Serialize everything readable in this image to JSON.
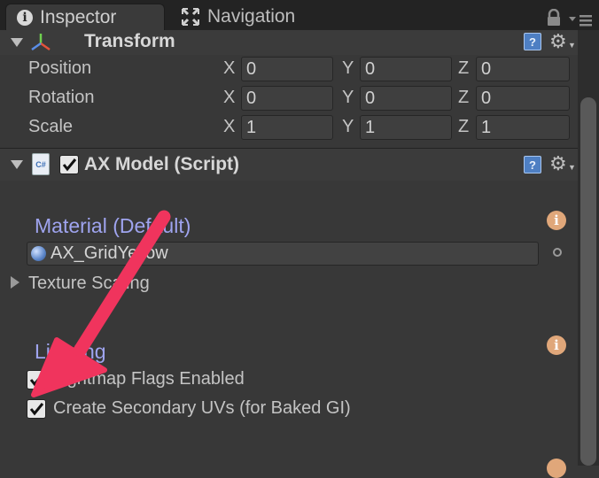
{
  "tabs": {
    "inspector": "Inspector",
    "navigation": "Navigation"
  },
  "transform": {
    "title": "Transform",
    "rows": [
      {
        "label": "Position",
        "x": "0",
        "y": "0",
        "z": "0"
      },
      {
        "label": "Rotation",
        "x": "0",
        "y": "0",
        "z": "0"
      },
      {
        "label": "Scale",
        "x": "1",
        "y": "1",
        "z": "1"
      }
    ],
    "axes": {
      "x": "X",
      "y": "Y",
      "z": "Z"
    }
  },
  "script_component": {
    "title": "AX Model (Script)",
    "icon_text": "C#",
    "enabled": true
  },
  "material_section": {
    "title": "Material (Default)",
    "field_value": "AX_GridYellow",
    "texture_scaling_label": "Texture Scaling"
  },
  "lighting_section": {
    "title": "Lighting",
    "lightmap_flags_label": "Lightmap Flags Enabled",
    "lightmap_flags_checked": true,
    "secondary_uvs_label": "Create Secondary UVs (for Baked GI)",
    "secondary_uvs_checked": true
  },
  "help_icon_text": "?",
  "info_icon_text": "i",
  "colors": {
    "annotation_arrow": "#f0345d",
    "section_title": "#9fa4ef",
    "panel_bg": "#383838"
  }
}
